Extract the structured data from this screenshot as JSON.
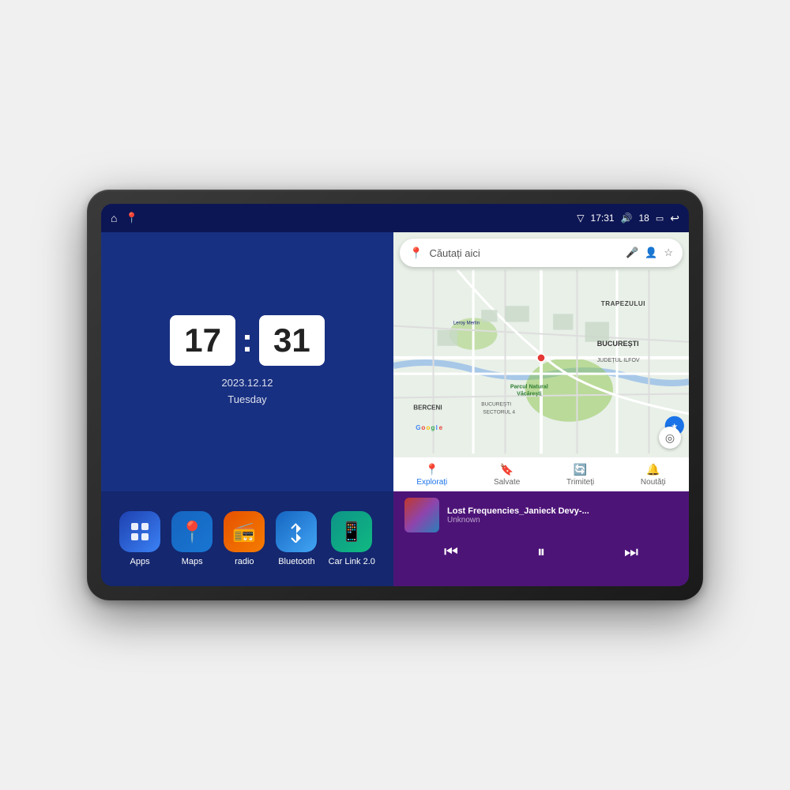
{
  "device": {
    "screen": {
      "status_bar": {
        "left_icons": [
          "home-icon",
          "maps-icon"
        ],
        "time": "17:31",
        "signal_icon": "signal",
        "volume_icon": "volume",
        "volume_level": "18",
        "battery_icon": "battery",
        "back_icon": "back"
      },
      "clock_widget": {
        "hour": "17",
        "minute": "31",
        "date": "2023.12.12",
        "day": "Tuesday"
      },
      "map_widget": {
        "search_placeholder": "Căutați aici",
        "nav_items": [
          {
            "label": "Explorați",
            "icon": "📍",
            "active": true
          },
          {
            "label": "Salvate",
            "icon": "🔖",
            "active": false
          },
          {
            "label": "Trimiteți",
            "icon": "🔄",
            "active": false
          },
          {
            "label": "Noutăți",
            "icon": "🔔",
            "active": false
          }
        ],
        "area_labels": [
          "TRAPEZULUI",
          "BUCUREȘTI",
          "JUDEȚUL ILFOV",
          "BERCENI",
          "BUCUREȘTI\nSECTORUL 4"
        ],
        "poi_labels": [
          "Parcul Natural Văcărești",
          "Leroy Merlin",
          "Google"
        ]
      },
      "apps": [
        {
          "name": "Apps",
          "icon": "⊞",
          "bg": "#2563eb"
        },
        {
          "name": "Maps",
          "icon": "📍",
          "bg": "#1a73e8"
        },
        {
          "name": "radio",
          "icon": "📻",
          "bg": "#f97316"
        },
        {
          "name": "Bluetooth",
          "icon": "🔷",
          "bg": "#3b82f6"
        },
        {
          "name": "Car Link 2.0",
          "icon": "📱",
          "bg": "#10b981"
        }
      ],
      "music_player": {
        "title": "Lost Frequencies_Janieck Devy-...",
        "artist": "Unknown",
        "controls": {
          "prev": "⏮",
          "play_pause": "⏸",
          "next": "⏭"
        }
      }
    }
  }
}
